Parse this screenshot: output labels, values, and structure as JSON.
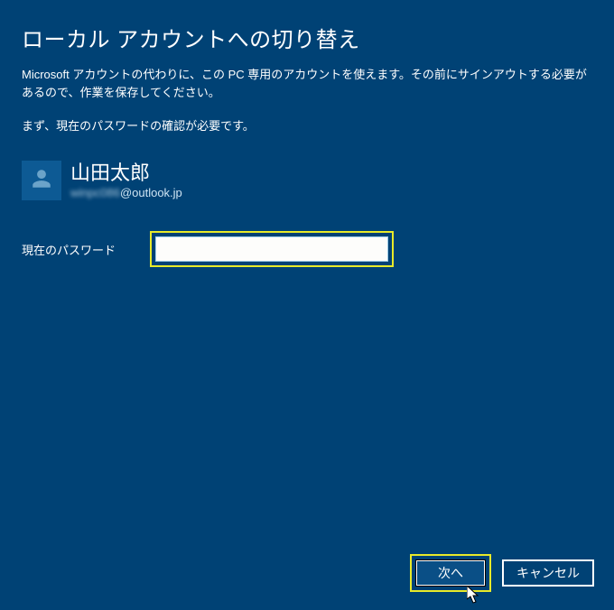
{
  "title": "ローカル アカウントへの切り替え",
  "description": "Microsoft アカウントの代わりに、この PC 専用のアカウントを使えます。その前にサインアウトする必要があるので、作業を保存してください。",
  "description2": "まず、現在のパスワードの確認が必要です。",
  "user": {
    "name": "山田太郎",
    "email_local": "winpc086",
    "email_domain": "@outlook.jp"
  },
  "field": {
    "password_label": "現在のパスワード",
    "password_value": ""
  },
  "buttons": {
    "next": "次へ",
    "cancel": "キャンセル"
  }
}
